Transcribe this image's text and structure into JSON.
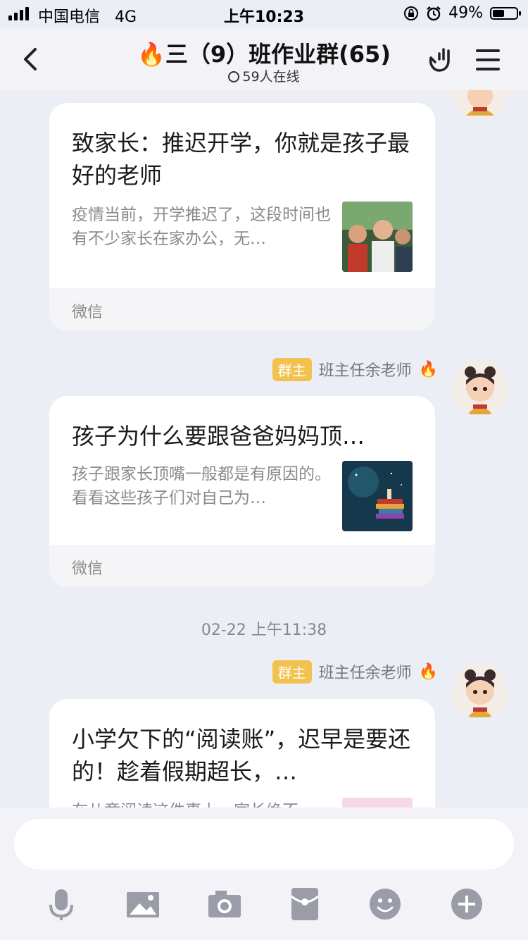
{
  "status_bar": {
    "carrier": "中国电信",
    "network": "4G",
    "time": "上午10:23",
    "battery": "49%",
    "battery_level": 0.49
  },
  "header": {
    "title": "🔥三（9）班作业群(65)",
    "online": "59人在线"
  },
  "messages": [
    {
      "title": "致家长：推迟开学，你就是孩子最好的老师",
      "desc": "疫情当前，开学推迟了，这段时间也有不少家长在家办公，无…",
      "source": "微信",
      "thumb_icon": "classroom-photo"
    },
    {
      "sender_role": "群主",
      "sender_name": "班主任余老师",
      "title": "孩子为什么要跟爸爸妈妈顶…",
      "desc": "孩子跟家长顶嘴一般都是有原因的。看看这些孩子们对自己为…",
      "source": "微信",
      "thumb_icon": "books-night-photo"
    },
    {
      "timestamp": "02-22 上午11:38",
      "sender_role": "群主",
      "sender_name": "班主任余老师",
      "title": "小学欠下的“阅读账”，迟早是要还的！趁着假期超长，…",
      "desc": "在儿童阅读这件事上，家长绝不",
      "thumb_icon": "pink-photo"
    }
  ],
  "toolbar": {
    "icons": [
      "microphone-icon",
      "image-icon",
      "camera-icon",
      "red-packet-icon",
      "emoji-icon",
      "plus-icon"
    ]
  },
  "colors": {
    "accent_badge": "#f2c14e",
    "chat_background": "#eceef6"
  }
}
